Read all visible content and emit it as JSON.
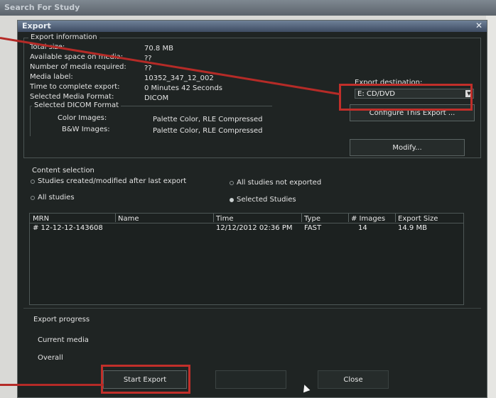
{
  "background": {
    "title": "Search For Study"
  },
  "window": {
    "title": "Export",
    "close_icon": "✕"
  },
  "export_info": {
    "group_title": "Export information",
    "rows": [
      {
        "label": "Total size:",
        "value": "70.8 MB"
      },
      {
        "label": "Available space on media:",
        "value": "??"
      },
      {
        "label": "Number of media required:",
        "value": "??"
      },
      {
        "label": "Media label:",
        "value": "10352_347_12_002"
      },
      {
        "label": "Time to complete export:",
        "value": "0 Minutes 42 Seconds"
      },
      {
        "label": "Selected Media Format:",
        "value": "DICOM"
      }
    ],
    "dicom_group_title": "Selected DICOM Format",
    "color_images_label": "Color Images:",
    "color_images_value": "Palette Color, RLE Compressed",
    "bw_images_label": "B&W Images:",
    "bw_images_value": "Palette Color, RLE Compressed"
  },
  "destination": {
    "label": "Export destination:",
    "selected": "E: CD/DVD",
    "configure_button": "Configure This Export ...",
    "modify_button": "Modify..."
  },
  "content_selection": {
    "title": "Content selection",
    "options": [
      {
        "label": "Studies created/modified after last export",
        "selected": false
      },
      {
        "label": "All studies not exported",
        "selected": false
      },
      {
        "label": "All studies",
        "selected": false
      },
      {
        "label": "Selected Studies",
        "selected": true
      }
    ]
  },
  "table": {
    "columns": [
      "MRN",
      "Name",
      "Time",
      "Type",
      "# Images",
      "Export Size"
    ],
    "rows": [
      {
        "mrn": "# 12-12-12-143608",
        "name": "",
        "time": "12/12/2012 02:36 PM",
        "type": "FAST",
        "images": "14",
        "size": "14.9 MB"
      }
    ]
  },
  "progress": {
    "title": "Export progress",
    "current_media": "Current media",
    "overall": "Overall"
  },
  "buttons": {
    "start_export": "Start Export",
    "close": "Close"
  },
  "colors": {
    "highlight": "#c12f2a",
    "panel_bg": "#1f2423",
    "title_bar": "#4a5a70"
  }
}
